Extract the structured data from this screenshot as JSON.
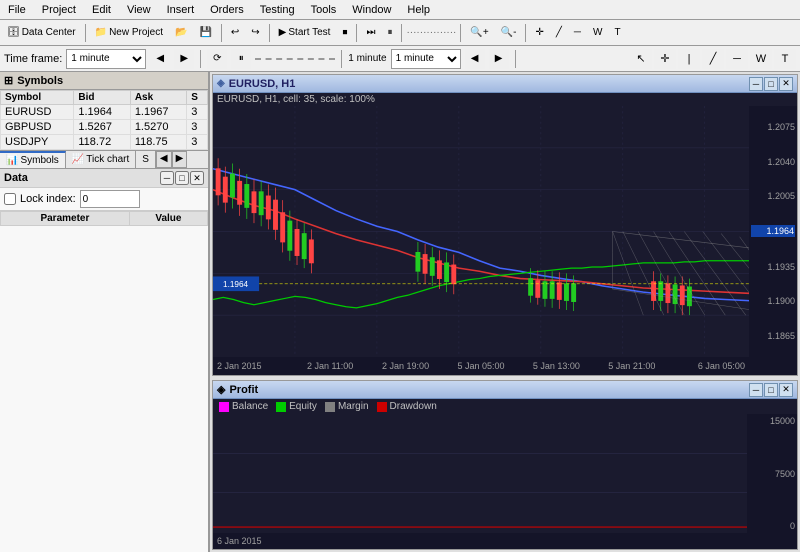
{
  "menu": {
    "items": [
      "File",
      "Project",
      "Edit",
      "View",
      "Insert",
      "Orders",
      "Testing",
      "Tools",
      "Window",
      "Help"
    ]
  },
  "toolbar": {
    "data_center": "Data Center",
    "new_project": "New Project",
    "start_test": "Start Test"
  },
  "timeframe": {
    "label": "Time frame:",
    "value": "1 minute",
    "right_value": "1 minute"
  },
  "symbols_panel": {
    "header": "Symbols",
    "columns": [
      "Symbol",
      "Bid",
      "Ask",
      "S"
    ],
    "rows": [
      {
        "symbol": "EURUSD",
        "bid": "1.1964",
        "ask": "1.1967",
        "s": "3"
      },
      {
        "symbol": "GBPUSD",
        "bid": "1.5267",
        "ask": "1.5270",
        "s": "3"
      },
      {
        "symbol": "USDJPY",
        "bid": "118.72",
        "ask": "118.75",
        "s": "3"
      }
    ]
  },
  "left_tabs": [
    {
      "label": "Symbols",
      "icon": "📊"
    },
    {
      "label": "Tick chart",
      "icon": "📈"
    },
    {
      "label": "S",
      "icon": ""
    }
  ],
  "data_panel": {
    "header": "Data",
    "lock_label": "Lock index:",
    "lock_value": "0",
    "columns": [
      "Parameter",
      "Value"
    ]
  },
  "chart_window": {
    "title": "EURUSD, H1",
    "info_bar": "EURUSD, H1, cell: 35, scale: 100%",
    "price_labels": [
      "1.2075",
      "1.2040",
      "1.2005",
      "1.1964",
      "1.1935",
      "1.1900",
      "1.1865"
    ],
    "time_labels": [
      "2 Jan 2015",
      "2 Jan 11:00",
      "2 Jan 19:00",
      "5 Jan 05:00",
      "5 Jan 13:00",
      "5 Jan 21:00",
      "6 Jan 05:00"
    ],
    "current_price": "1.1964"
  },
  "profit_window": {
    "title": "Profit",
    "legend": [
      {
        "label": "Balance",
        "color": "#ff00ff",
        "type": "line"
      },
      {
        "label": "Equity",
        "color": "#00cc00",
        "type": "fill"
      },
      {
        "label": "Margin",
        "color": "#808080",
        "type": "fill"
      },
      {
        "label": "Drawdown",
        "color": "#cc0000",
        "type": "fill"
      }
    ],
    "y_labels": [
      "15000",
      "7500",
      "0"
    ],
    "x_label": "6 Jan 2015"
  },
  "icons": {
    "minimize": "─",
    "maximize": "□",
    "close": "✕",
    "chart_icon": "◈"
  }
}
